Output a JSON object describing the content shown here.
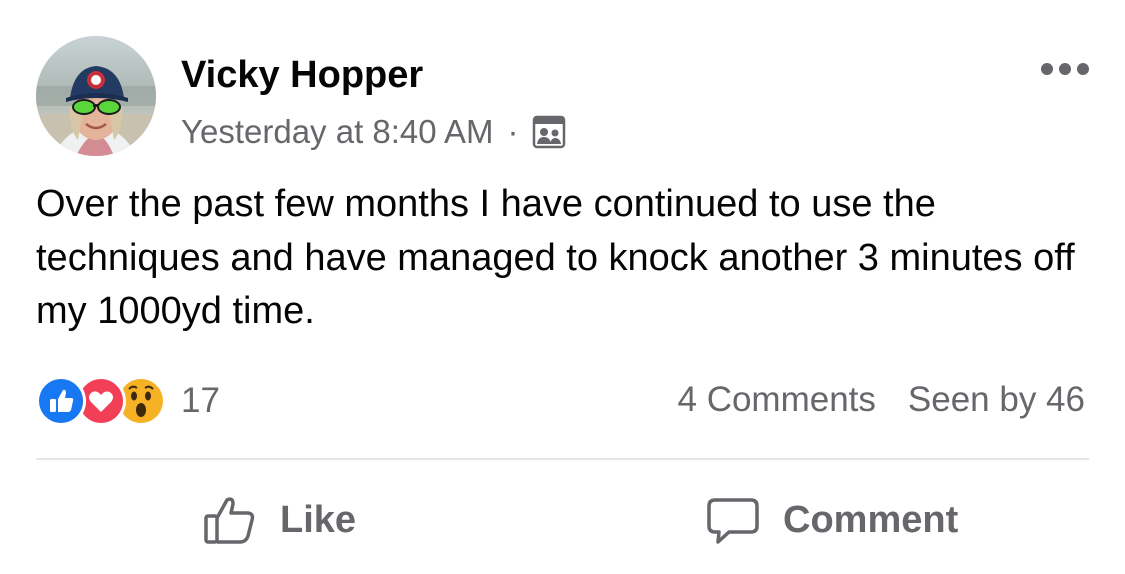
{
  "post": {
    "author": {
      "name": "Vicky Hopper",
      "avatar_icon": "profile-photo"
    },
    "timestamp": "Yesterday at 8:40 AM",
    "meta_separator": "·",
    "audience_icon": "group-members-icon",
    "more_icon": "more-options-icon",
    "text": "Over the past few months I have continued to use the techniques and have managed to knock another 3 minutes off my 1000yd time.",
    "reactions": {
      "icons": [
        "like-reaction-icon",
        "love-reaction-icon",
        "wow-reaction-icon"
      ],
      "count": "17"
    },
    "comments_label": "4 Comments",
    "seen_by_label": "Seen by 46",
    "actions": {
      "like_label": "Like",
      "comment_label": "Comment"
    },
    "colors": {
      "like_blue": "#1877f2",
      "love_red": "#f33e58",
      "wow_yellow": "#f7b125",
      "secondary_text": "#65676b",
      "primary_text": "#050505",
      "divider": "#e4e6eb"
    }
  }
}
